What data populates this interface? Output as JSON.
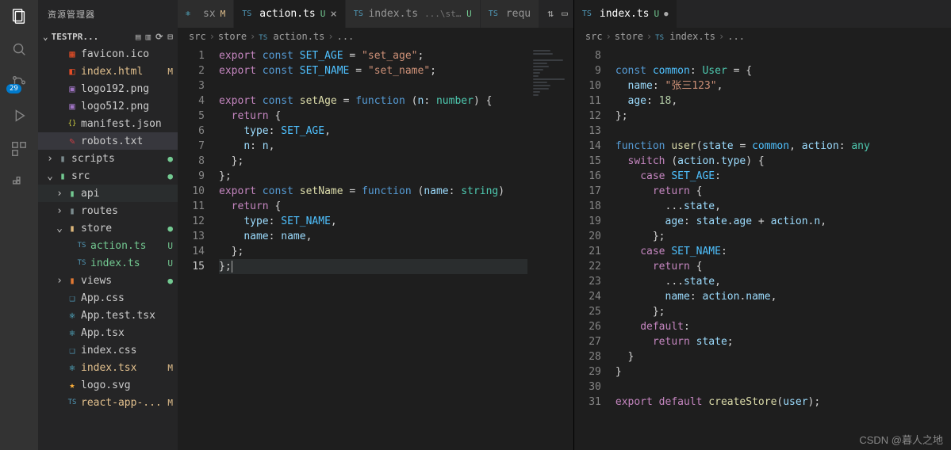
{
  "activity": {
    "badge": "29"
  },
  "sidebar": {
    "title": "资源管理器",
    "header": "TESTPR...",
    "items": [
      {
        "indent": 1,
        "tw": "",
        "icon": "ic-html",
        "glyph": "▦",
        "label": "favicon.ico",
        "status": "",
        "cls": ""
      },
      {
        "indent": 1,
        "tw": "",
        "icon": "ic-html",
        "glyph": "◧",
        "label": "index.html",
        "status": "M",
        "cls": "modified"
      },
      {
        "indent": 1,
        "tw": "",
        "icon": "ic-img",
        "glyph": "▣",
        "label": "logo192.png",
        "status": "",
        "cls": ""
      },
      {
        "indent": 1,
        "tw": "",
        "icon": "ic-img",
        "glyph": "▣",
        "label": "logo512.png",
        "status": "",
        "cls": ""
      },
      {
        "indent": 1,
        "tw": "",
        "icon": "ic-json",
        "glyph": "{}",
        "label": "manifest.json",
        "status": "",
        "cls": ""
      },
      {
        "indent": 1,
        "tw": "",
        "icon": "ic-txt",
        "glyph": "✎",
        "label": "robots.txt",
        "status": "",
        "cls": "",
        "selected": true
      },
      {
        "indent": 0,
        "tw": "›",
        "icon": "ic-routes",
        "glyph": "▮",
        "label": "scripts",
        "status": "●",
        "cls": "",
        "statusCls": "dot"
      },
      {
        "indent": 0,
        "tw": "⌄",
        "icon": "ic-folder",
        "glyph": "▮",
        "label": "src",
        "status": "●",
        "cls": "",
        "statusCls": "dot"
      },
      {
        "indent": 1,
        "tw": "›",
        "icon": "ic-folder",
        "glyph": "▮",
        "label": "api",
        "status": "",
        "cls": "",
        "hl": true
      },
      {
        "indent": 1,
        "tw": "›",
        "icon": "ic-routes",
        "glyph": "▮",
        "label": "routes",
        "status": "",
        "cls": ""
      },
      {
        "indent": 1,
        "tw": "⌄",
        "icon": "ic-folder2",
        "glyph": "▮",
        "label": "store",
        "status": "●",
        "cls": "",
        "statusCls": "dot"
      },
      {
        "indent": 2,
        "tw": "",
        "icon": "ic-ts",
        "glyph": "TS",
        "label": "action.ts",
        "status": "U",
        "cls": "untracked"
      },
      {
        "indent": 2,
        "tw": "",
        "icon": "ic-ts",
        "glyph": "TS",
        "label": "index.ts",
        "status": "U",
        "cls": "untracked"
      },
      {
        "indent": 1,
        "tw": "›",
        "icon": "ic-views",
        "glyph": "▮",
        "label": "views",
        "status": "●",
        "cls": "",
        "statusCls": "dot"
      },
      {
        "indent": 1,
        "tw": "",
        "icon": "ic-css",
        "glyph": "❑",
        "label": "App.css",
        "status": "",
        "cls": ""
      },
      {
        "indent": 1,
        "tw": "",
        "icon": "ic-react",
        "glyph": "⚛",
        "label": "App.test.tsx",
        "status": "",
        "cls": ""
      },
      {
        "indent": 1,
        "tw": "",
        "icon": "ic-react",
        "glyph": "⚛",
        "label": "App.tsx",
        "status": "",
        "cls": ""
      },
      {
        "indent": 1,
        "tw": "",
        "icon": "ic-css",
        "glyph": "❑",
        "label": "index.css",
        "status": "",
        "cls": ""
      },
      {
        "indent": 1,
        "tw": "",
        "icon": "ic-react",
        "glyph": "⚛",
        "label": "index.tsx",
        "status": "M",
        "cls": "modified"
      },
      {
        "indent": 1,
        "tw": "",
        "icon": "ic-svg",
        "glyph": "★",
        "label": "logo.svg",
        "status": "",
        "cls": ""
      },
      {
        "indent": 1,
        "tw": "",
        "icon": "ic-ts",
        "glyph": "TS",
        "label": "react-app-...",
        "status": "M",
        "cls": "modified"
      }
    ]
  },
  "editor_left": {
    "tabs": [
      {
        "icon": "ic-react",
        "glyph": "⚛",
        "label": "sx",
        "status": "M",
        "active": false,
        "partial": true
      },
      {
        "icon": "ic-ts",
        "glyph": "TS",
        "label": "action.ts",
        "status": "U",
        "active": true,
        "close": true
      },
      {
        "icon": "ic-ts",
        "glyph": "TS",
        "label": "index.ts",
        "desc": "...\\store",
        "status": "U",
        "active": false
      },
      {
        "icon": "ic-ts",
        "glyph": "TS",
        "label": "requ",
        "active": false,
        "partial": true
      }
    ],
    "actions": [
      "⇅",
      "▭",
      "⋯"
    ],
    "breadcrumbs": [
      "src",
      "store",
      "TS action.ts",
      "..."
    ],
    "line_start": 1,
    "current_line": 15
  },
  "editor_right": {
    "tabs": [
      {
        "icon": "ic-ts",
        "glyph": "TS",
        "label": "index.ts",
        "status": "U",
        "active": true,
        "dot": true
      }
    ],
    "breadcrumbs": [
      "src",
      "store",
      "TS index.ts",
      "..."
    ],
    "line_start": 8
  },
  "watermark": "CSDN @暮人之地"
}
